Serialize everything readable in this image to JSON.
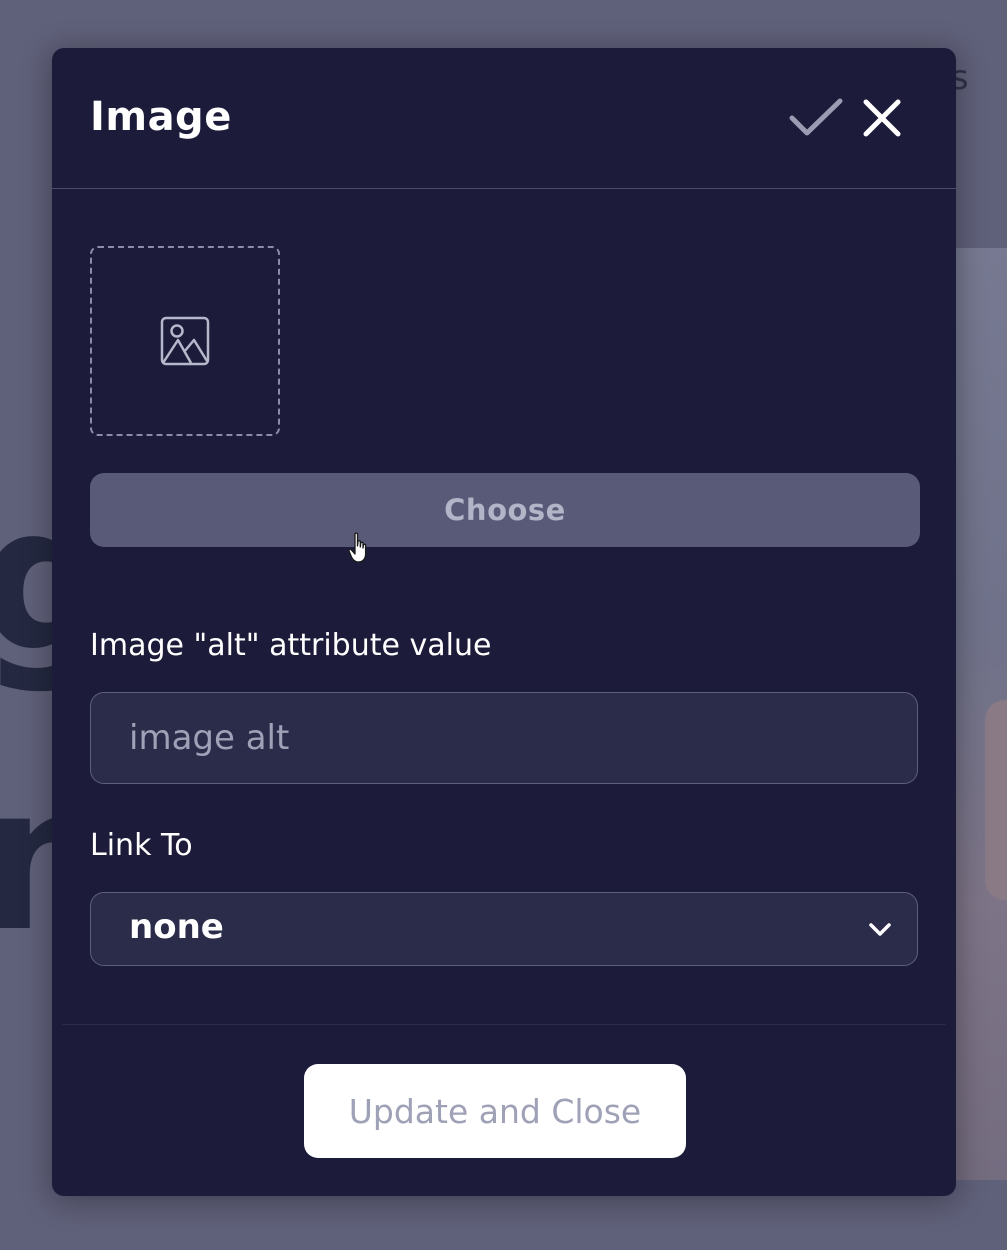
{
  "background": {
    "corner_text": "es",
    "big_letters": [
      "g",
      "n"
    ]
  },
  "modal": {
    "title": "Image",
    "confirm_icon": "check-icon",
    "close_icon": "close-icon",
    "placeholder_icon": "image-icon",
    "choose_label": "Choose",
    "alt_field": {
      "label": "Image \"alt\" attribute value",
      "value": "",
      "placeholder": "image alt"
    },
    "link_field": {
      "label": "Link To",
      "selected": "none",
      "chevron_icon": "chevron-down-icon"
    },
    "update_label": "Update and Close"
  },
  "colors": {
    "modal_bg": "#1c1c3a",
    "overlay": "#5f6079",
    "choose_bg": "#585a77",
    "input_bg": "#2b2b4a",
    "primary_button_bg": "#ffffff"
  }
}
